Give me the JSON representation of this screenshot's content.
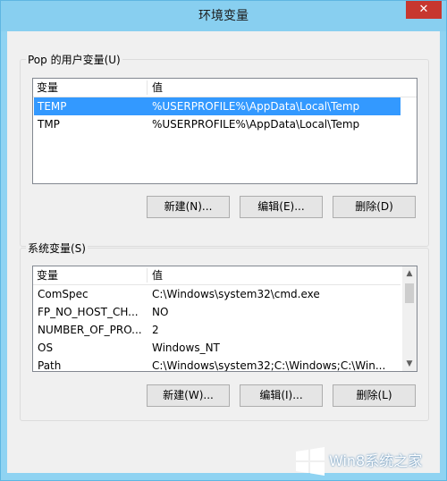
{
  "window": {
    "title": "环境变量",
    "close_glyph": "✕"
  },
  "user_vars": {
    "label": "Pop 的用户变量(U)",
    "columns": [
      "变量",
      "值"
    ],
    "rows": [
      {
        "name": "TEMP",
        "value": "%USERPROFILE%\\AppData\\Local\\Temp",
        "selected": true
      },
      {
        "name": "TMP",
        "value": "%USERPROFILE%\\AppData\\Local\\Temp",
        "selected": false
      }
    ],
    "buttons": {
      "new": "新建(N)...",
      "edit": "编辑(E)...",
      "delete": "删除(D)"
    }
  },
  "system_vars": {
    "label": "系统变量(S)",
    "columns": [
      "变量",
      "值"
    ],
    "rows": [
      {
        "name": "ComSpec",
        "value": "C:\\Windows\\system32\\cmd.exe"
      },
      {
        "name": "FP_NO_HOST_CH...",
        "value": "NO"
      },
      {
        "name": "NUMBER_OF_PRO...",
        "value": "2"
      },
      {
        "name": "OS",
        "value": "Windows_NT"
      },
      {
        "name": "Path",
        "value": "C:\\Windows\\system32;C:\\Windows;C:\\Win..."
      }
    ],
    "buttons": {
      "new": "新建(W)...",
      "edit": "编辑(I)...",
      "delete": "删除(L)"
    }
  },
  "watermark": {
    "text": "Win8系统之家",
    "logo_icon": "windows-logo-icon"
  },
  "colors": {
    "selection": "#3399ff",
    "titlebar": "#88cff0",
    "close": "#c7372f"
  }
}
